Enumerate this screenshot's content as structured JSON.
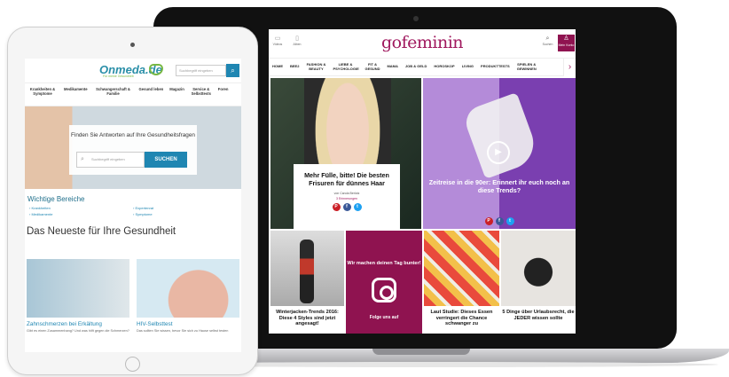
{
  "laptop": {
    "site": {
      "logo": "gofeminin",
      "top_left": [
        {
          "icon": "video-icon",
          "label": "Videos"
        },
        {
          "icon": "tablet-icon",
          "label": "Alben"
        }
      ],
      "search_label": "Suchen",
      "login_label": "Mein Konto",
      "nav": [
        "HOME",
        "BEE2",
        "FASHION & BEAUTY",
        "LIEBE & PSYCHOLOGIE",
        "FIT & GESUND",
        "MAMA",
        "JOB & GELD",
        "HOROSKOP",
        "LIVING",
        "PRODUKTTESTS",
        "SPIELEN & GEWINNEN"
      ],
      "hero": {
        "title": "Mehr Fülle, bitte! Die besten Frisuren für dünnes Haar",
        "author": "von Carola Berlotz",
        "count": "3 Erinnerungen"
      },
      "video": {
        "title": "Zeitreise in die 90er: Erinnert ihr euch noch an diese Trends?"
      },
      "cards": [
        "Winterjacken-Trends 2016: Diese 4 Styles sind jetzt angesagt!",
        "Laut Studie: Dieses Essen verringert die Chance schwanger zu",
        "5 Dinge über Urlaubsrecht, die JEDER wissen sollte"
      ],
      "insta": {
        "text": "Wir machen deinen Tag bunter!",
        "more": "Folge uns auf"
      }
    }
  },
  "tablet": {
    "site": {
      "logo": "Onmeda.de",
      "tagline": "Für meine Gesundheit",
      "search_placeholder": "Suchbegriff eingeben",
      "nav": [
        "Krankheiten & Symptome",
        "Medikamente",
        "Schwangerschaft & Familie",
        "Gesund leben",
        "Magazin",
        "Service & Selbsttests",
        "Foren"
      ],
      "hero": {
        "question": "Finden Sie Antworten auf Ihre Gesundheitsfragen",
        "input_placeholder": "Suchbegriff eingeben",
        "button": "SUCHEN"
      },
      "section1": "Wichtige Bereiche",
      "links": [
        "Krankheiten",
        "Expertenrat",
        "Medikamente",
        "Symptome"
      ],
      "section2": "Das Neueste für Ihre Gesundheit",
      "articles": [
        {
          "title": "Zahnschmerzen bei Erkältung",
          "desc": "Gibt es einen Zusammenhang? Und was hilft gegen die Schmerzen?"
        },
        {
          "title": "HIV-Selbsttest",
          "desc": "Das sollten Sie wissen, bevor Sie sich zu Hause selbst testen"
        }
      ]
    }
  }
}
